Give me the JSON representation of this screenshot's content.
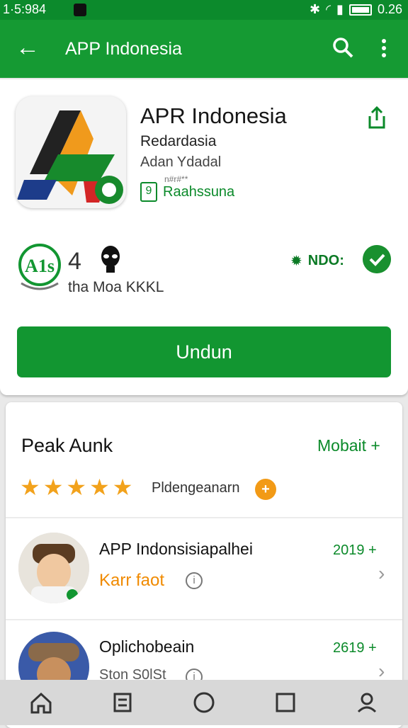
{
  "status_bar": {
    "time": "1·5:984",
    "battery": "0.26"
  },
  "app_bar": {
    "title": "APP Indonesia",
    "back_icon": "arrow-left-icon",
    "search_icon": "search-icon",
    "more_icon": "more-vert-icon"
  },
  "app": {
    "name": "APR Indonesia",
    "developer": "Redardasia",
    "category": "Adan Ydadal",
    "small_text": "n#r#**",
    "badge_text": "Raahssuna",
    "rating_number": "4",
    "rating_label": "tha",
    "downloads_label": "Moa KKKL",
    "status_text": "NDO:",
    "install_label": "Undun"
  },
  "reviews": {
    "title": "Peak Aunk",
    "link": "Mobait +",
    "subtitle": "Pldengeanarn",
    "coin_symbol": "+",
    "stars": [
      "★",
      "★",
      "★",
      "★",
      "★"
    ],
    "items": [
      {
        "name": "APP Indonsisiapalhei",
        "meta": "Karr faot",
        "year": "2019 +"
      },
      {
        "name": "Oplichobeain",
        "meta": "Ston S0lSt",
        "year": "2619 +"
      }
    ]
  },
  "colors": {
    "brand_green": "#159a33",
    "accent_orange": "#f2a21c"
  }
}
